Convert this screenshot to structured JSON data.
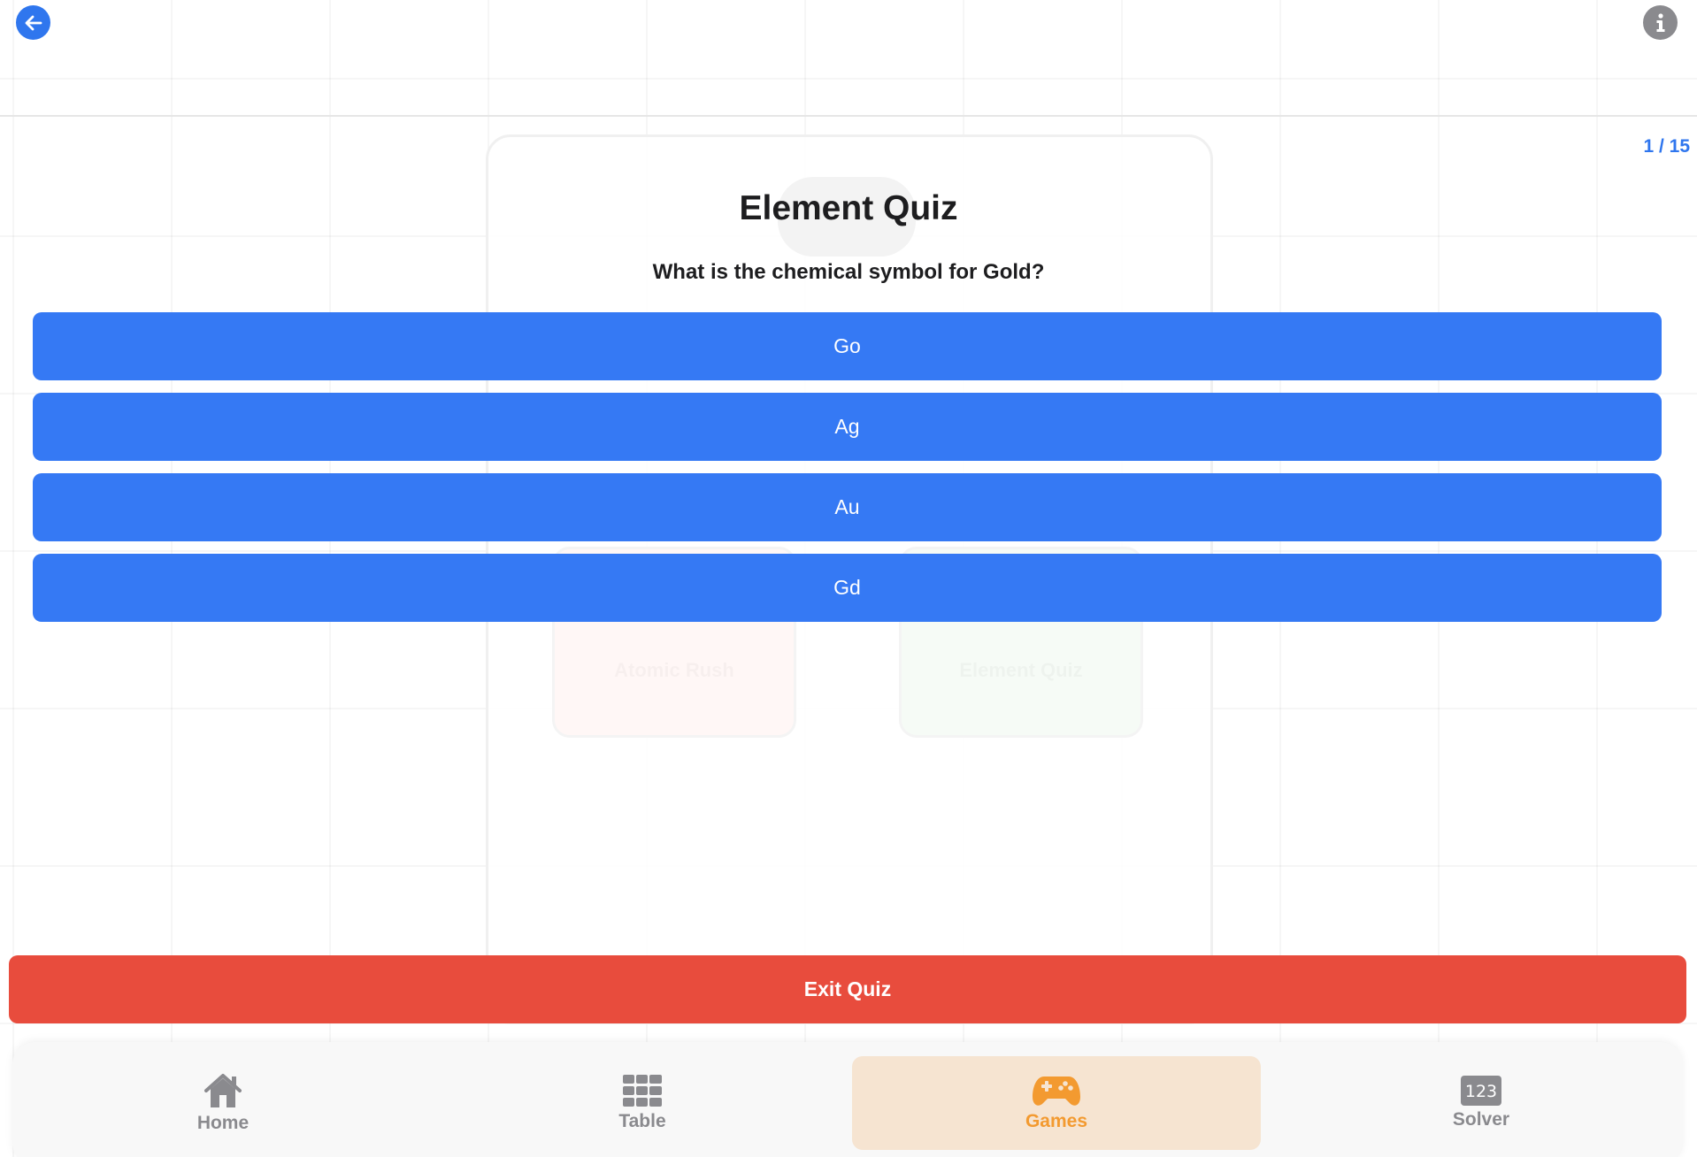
{
  "header": {
    "back_icon": "arrow-left-icon",
    "info_icon": "info-icon",
    "progress": "1 / 15"
  },
  "background": {
    "tile_left_label": "Atomic Rush",
    "tile_right_label": "Element Quiz"
  },
  "quiz": {
    "title": "Element Quiz",
    "question": "What is the chemical symbol for Gold?",
    "answers": [
      "Go",
      "Ag",
      "Au",
      "Gd"
    ],
    "exit_label": "Exit Quiz"
  },
  "tabs": [
    {
      "label": "Home",
      "icon": "house-icon",
      "active": false
    },
    {
      "label": "Table",
      "icon": "table-icon",
      "active": false
    },
    {
      "label": "Games",
      "icon": "gamecontroller-icon",
      "active": true
    },
    {
      "label": "Solver",
      "icon": "number-123-icon",
      "active": false
    }
  ],
  "colors": {
    "accent": "#2f76ee",
    "answer": "#3579f4",
    "exit": "#e84c3d",
    "active_tab": "#f39a30",
    "active_tab_bg": "#f6e4d1",
    "inactive_tab": "#8a8a8e"
  }
}
